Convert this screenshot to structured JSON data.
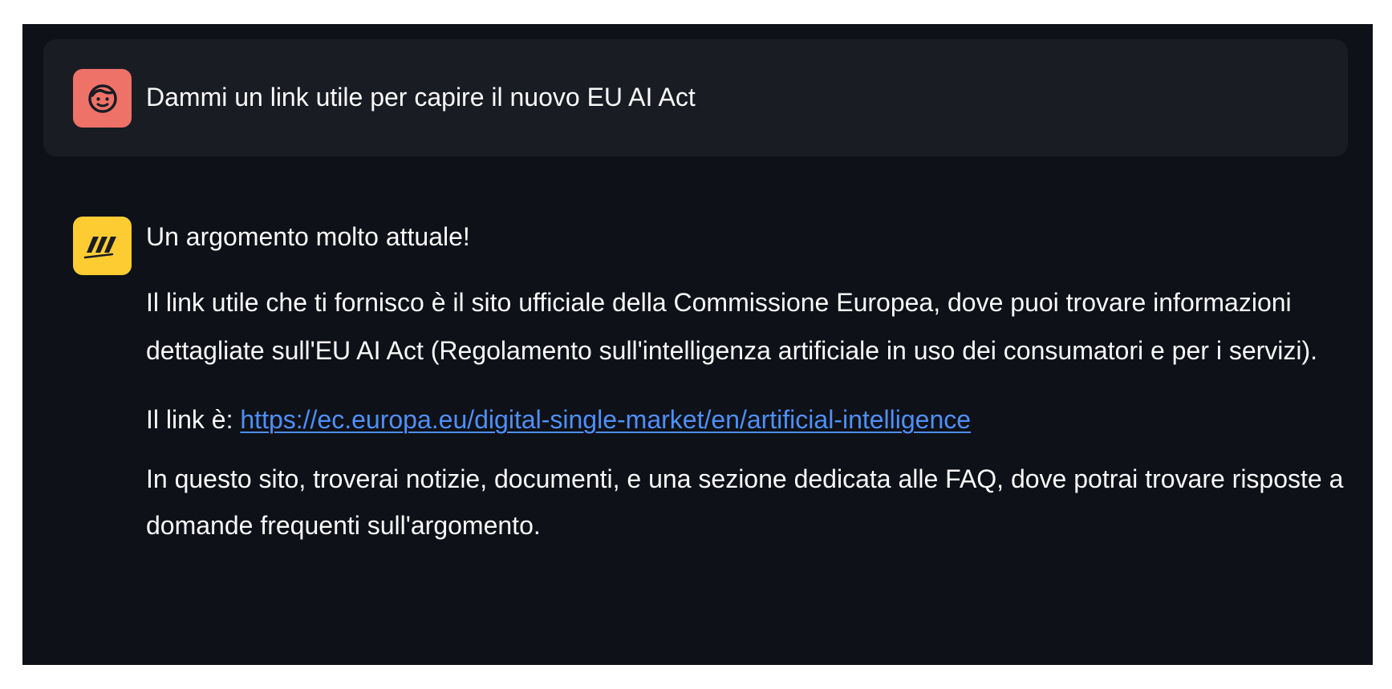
{
  "colors": {
    "page_background": "#ffffff",
    "chat_background": "#0e1117",
    "user_bubble_background": "#1a1c24",
    "user_avatar": "#ef7268",
    "assistant_avatar": "#fccc32",
    "text": "#fafafa",
    "link": "#4f8ff7"
  },
  "conversation": {
    "user_message": {
      "avatar_icon": "user-face-icon",
      "text": "Dammi un link utile per capire il nuovo EU AI Act"
    },
    "assistant_message": {
      "avatar_icon": "assistant-logo-icon",
      "intro": "Un argomento molto attuale!",
      "description": "Il link utile che ti fornisco è il sito ufficiale della Commissione Europea, dove puoi trovare informazioni dettagliate sull'EU AI Act (Regolamento sull'intelligenza artificiale in uso dei consumatori e per i servizi).",
      "link_prefix": "Il link è: ",
      "link_url": "https://ec.europa.eu/digital-single-market/en/artificial-intelligence",
      "closing": "In questo sito, troverai notizie, documenti, e una sezione dedicata alle FAQ, dove potrai trovare risposte a domande frequenti sull'argomento."
    }
  }
}
